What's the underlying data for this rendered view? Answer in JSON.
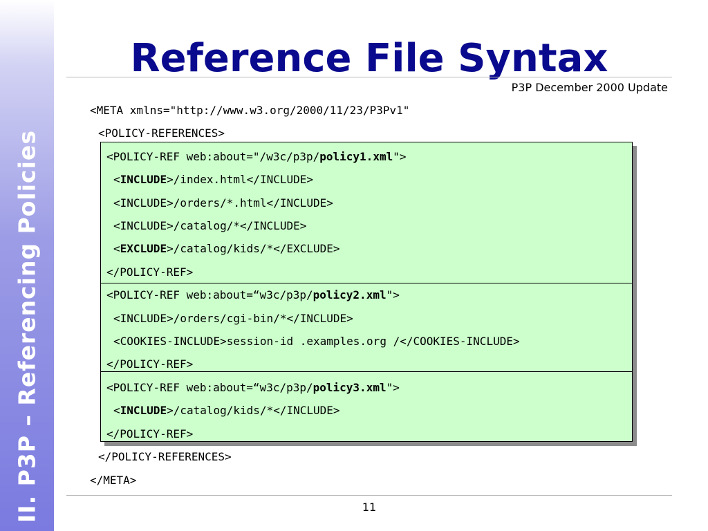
{
  "sidebar": {
    "label": "II. P3P – Referencing Policies"
  },
  "title": "Reference File Syntax",
  "subtitle": "P3P December 2000 Update",
  "page_number": "11",
  "code": {
    "meta_open": "<META xmlns=\"http://www.w3.org/2000/11/23/P3Pv1\"",
    "refs_open": "<POLICY-REFERENCES>",
    "p1_open_a": "<POLICY-REF web:about=\"/w3c/p3p/",
    "p1_file": "policy1.xml",
    "p1_open_b": "\">",
    "p1_inc1_a": "<",
    "p1_inc1_tag": "INCLUDE",
    "p1_inc1_b": ">/index.html</INCLUDE>",
    "p1_inc2": "<INCLUDE>/orders/*.html</INCLUDE>",
    "p1_inc3": "<INCLUDE>/catalog/*</INCLUDE>",
    "p1_exc_a": "<",
    "p1_exc_tag": "EXCLUDE",
    "p1_exc_b": ">/catalog/kids/*</EXCLUDE>",
    "p1_close": "</POLICY-REF>",
    "p2_open_a": "<POLICY-REF web:about=“w3c/p3p/",
    "p2_file": "policy2.xml",
    "p2_open_b": "\">",
    "p2_inc1": "<INCLUDE>/orders/cgi-bin/*</INCLUDE>",
    "p2_cookie": "<COOKIES-INCLUDE>session-id .examples.org /</COOKIES-INCLUDE>",
    "p2_close": "</POLICY-REF>",
    "p3_open_a": "<POLICY-REF web:about=“w3c/p3p/",
    "p3_file": "policy3.xml",
    "p3_open_b": "\">",
    "p3_inc_a": "<",
    "p3_inc_tag": "INCLUDE",
    "p3_inc_b": ">/catalog/kids/*</INCLUDE>",
    "p3_close": "</POLICY-REF>",
    "refs_close": "</POLICY-REFERENCES>",
    "meta_close": "</META>"
  },
  "colors": {
    "title": "#0a0a8e",
    "box_fill": "#ccffcc",
    "sidebar_bottom": "#7a7ae0"
  }
}
